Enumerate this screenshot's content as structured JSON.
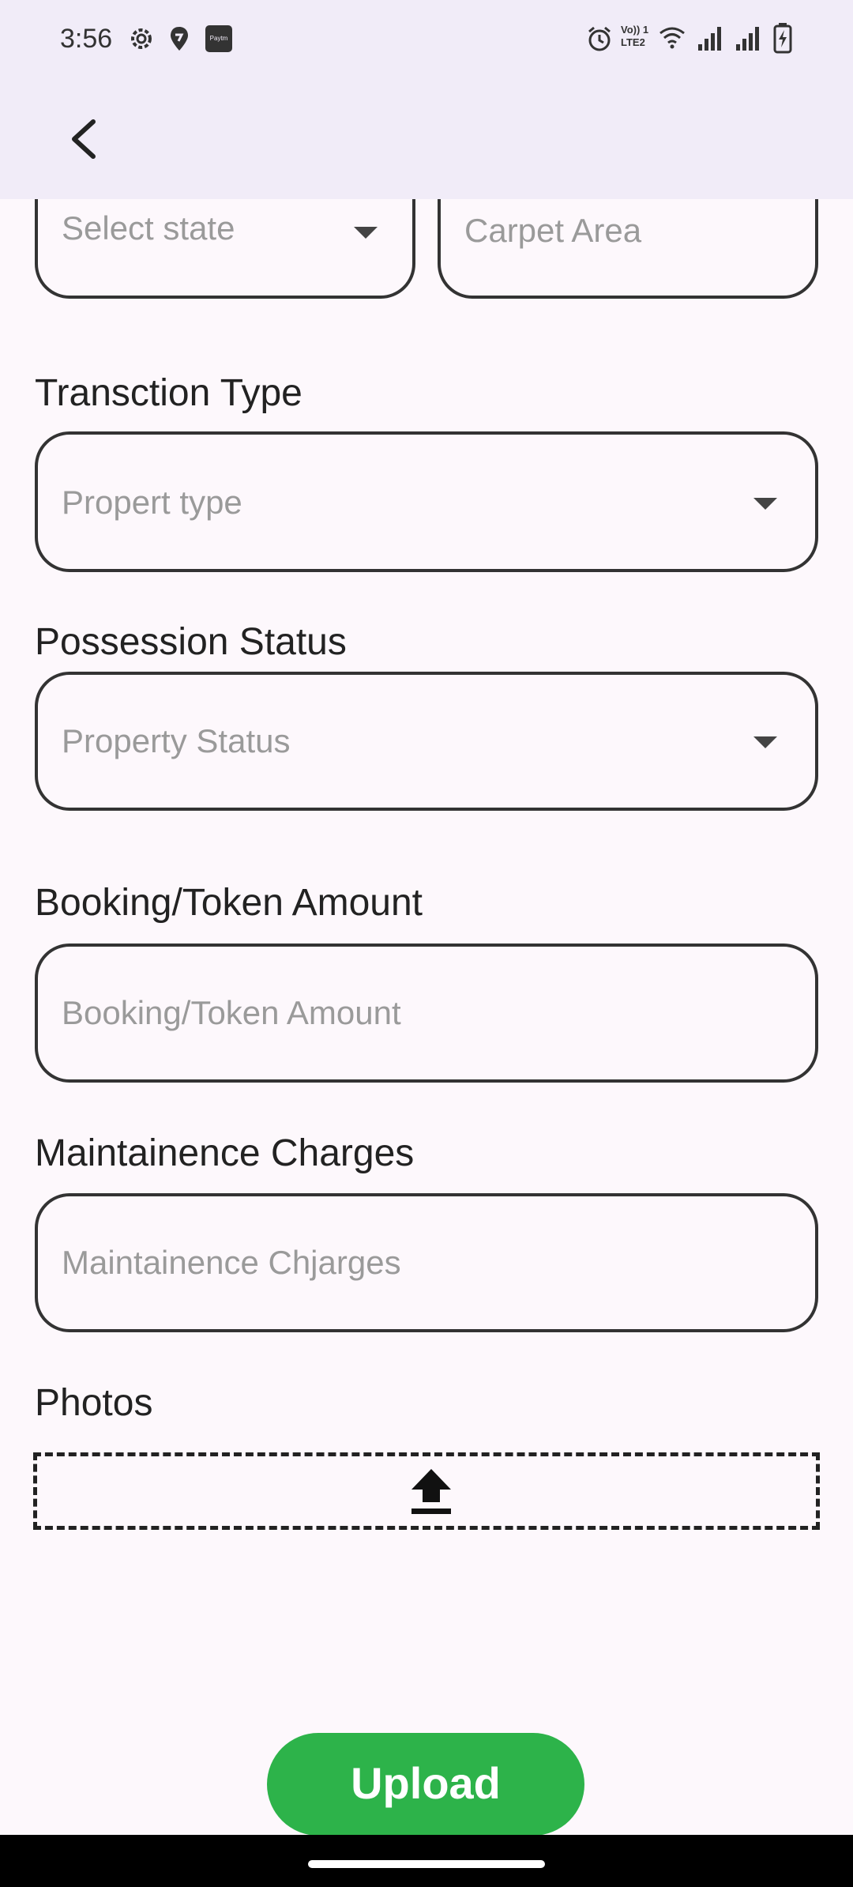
{
  "status_bar": {
    "time": "3:56",
    "icons": [
      "settings-icon",
      "swiggy-icon",
      "paytm-icon",
      "alarm-icon",
      "volte-icon",
      "wifi-icon",
      "signal-icon",
      "signal-icon",
      "battery-charging-icon"
    ],
    "volte_text_top": "Vo)) 1",
    "volte_text_bottom": "LTE2",
    "paytm_text": "Paytm"
  },
  "appbar": {
    "back_icon": "chevron-left-icon"
  },
  "form": {
    "state": {
      "placeholder": "Select state"
    },
    "carpet_area": {
      "placeholder": "Carpet Area"
    },
    "transaction_type": {
      "label": "Transction Type",
      "placeholder": "Propert type"
    },
    "possession_status": {
      "label": "Possession Status",
      "placeholder": "Property Status"
    },
    "booking_amount": {
      "label": "Booking/Token Amount",
      "placeholder": "Booking/Token Amount"
    },
    "maintenance": {
      "label": "Maintainence Charges",
      "placeholder": "Maintainence Chjarges"
    },
    "photos": {
      "label": "Photos",
      "icon": "upload-icon"
    }
  },
  "upload_button": {
    "label": "Upload"
  },
  "colors": {
    "accent": "#2db34a",
    "appbar": "#f1ecf8",
    "background": "#fdf8fc"
  }
}
